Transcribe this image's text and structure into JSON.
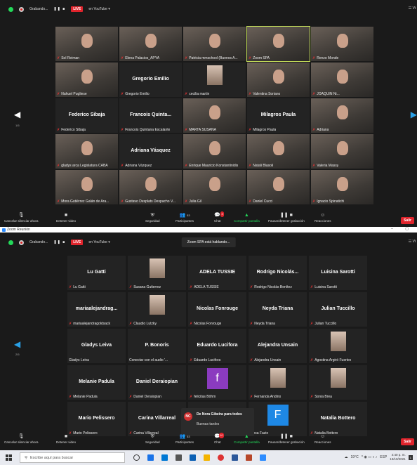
{
  "window1": {
    "recording_label": "Grabando...",
    "pause_controls": "❚❚ ■",
    "live_label": "LIVE",
    "live_target": "en YouTube ▾",
    "view_label": "☷ Vi",
    "page_indicator": "1/5",
    "tiles": [
      {
        "name": "Sol Reiman",
        "video": true
      },
      {
        "name": "Elena Palacios_APYA",
        "video": true
      },
      {
        "name": "Patricia mmschool (Buenos A...",
        "video": true
      },
      {
        "name": "Zoom SPA",
        "video": true,
        "active": true
      },
      {
        "name": "Renzo Monde",
        "video": true
      },
      {
        "name": "Nahuel Pugliese",
        "video": true
      },
      {
        "name": "Gregorio Emilio",
        "video": false,
        "center": "Gregorio Emilio"
      },
      {
        "name": "cecilia martin",
        "video": false,
        "photo": true
      },
      {
        "name": "Valentina Soriano",
        "video": true
      },
      {
        "name": "JOAQUIN Ni...",
        "video": true
      },
      {
        "name": "Federico Sibaja",
        "video": false,
        "center": "Federico Sibaja"
      },
      {
        "name": "Francois Quintana Escalante",
        "video": false,
        "center": "Francois Quinta..."
      },
      {
        "name": "MARTA SUSANA",
        "video": true
      },
      {
        "name": "Milagros Paula",
        "video": false,
        "center": "Milagros Paula"
      },
      {
        "name": "Adriana",
        "video": true
      },
      {
        "name": "gladys arca Legislatura CABA",
        "video": true
      },
      {
        "name": "Adriana Vázquez",
        "video": false,
        "center": "Adriana Vásquez"
      },
      {
        "name": "Enrique Mauricio Konstantinidis",
        "video": true
      },
      {
        "name": "Natali Blasoli",
        "video": true
      },
      {
        "name": "Valeria Massy",
        "video": true
      },
      {
        "name": "Mora Gutiérrez Galán de Ara...",
        "video": true
      },
      {
        "name": "Gustavo Desplats Despacho V...",
        "video": true
      },
      {
        "name": "Julia Gil",
        "video": true
      },
      {
        "name": "Daniel Cucci",
        "video": true
      },
      {
        "name": "Ignacio Spinatichi",
        "video": true
      }
    ],
    "toolbar": {
      "mute_label": "Cancelar silenciar ahora",
      "video_label": "Detener video",
      "security_label": "Seguridad",
      "participants_label": "Participantes",
      "participants_count": "53",
      "chat_label": "Chat",
      "chat_badge": "3",
      "share_label": "Compartir pantalla",
      "record_label": "Pausar/detener grabación",
      "reactions_label": "Reacciones",
      "end_label": "Salir"
    }
  },
  "zoom_titlebar": {
    "title": "Zoom Reunión",
    "controls": "–  ▢"
  },
  "window2": {
    "recording_label": "Grabando...",
    "pause_controls": "❚❚ ■",
    "live_label": "LIVE",
    "live_target": "en YouTube ▾",
    "view_label": "☷ Vi",
    "speaking": "Zoom SPA está hablando...",
    "page_indicator": "2/5",
    "tiles": [
      {
        "name": "Lu Gatti",
        "center": "Lu Gatti"
      },
      {
        "name": "Susana Gutierrez",
        "photo": true
      },
      {
        "name": "ADELA TUSSIE",
        "center": "ADELA TUSSIE"
      },
      {
        "name": "Rodrigo Nicolás Benítez",
        "center": "Rodrigo Nicolás..."
      },
      {
        "name": "Luisina Sarotti",
        "center": "Luisina Sarotti"
      },
      {
        "name": "mariaalejandragoldsack",
        "center": "mariaalejandrag..."
      },
      {
        "name": "Claudio Lutzky",
        "photo": true
      },
      {
        "name": "Nicolas Fonrouge",
        "center": "Nicolas Fonrouge"
      },
      {
        "name": "Neyda Triana",
        "center": "Neyda Triana"
      },
      {
        "name": "Julian Tuccillo",
        "center": "Julian Tuccillo"
      },
      {
        "name": "Gladys Leiva",
        "center": "Gladys Leiva",
        "nomute": true
      },
      {
        "name": "Conectar con el audio '...",
        "center": "P. Bonoris",
        "nomute": true
      },
      {
        "name": "Eduardo Lucifora",
        "center": "Eduardo Lucifora"
      },
      {
        "name": "Alejandra Unsain",
        "center": "Alejandra Unsain"
      },
      {
        "name": "Agostina Argiró Fuertes",
        "photo": true
      },
      {
        "name": "Melanie Padula",
        "center": "Melanie Padula"
      },
      {
        "name": "Daniel Deraiopian",
        "center": "Daniel Deraiopian"
      },
      {
        "name": "felicitas Böhm",
        "letter": "f",
        "color": "#8b3bbf"
      },
      {
        "name": "Fernanda Andino",
        "photo": true
      },
      {
        "name": "Sonia Brea",
        "photo": true
      },
      {
        "name": "Mario  Pelissero",
        "center": "Mario  Pelissero"
      },
      {
        "name": "Carina Villarreal",
        "center": "Carina Villarreal"
      },
      {
        "name": "",
        "center": ""
      },
      {
        "name": "eresa Fazio",
        "letter": "F",
        "color": "#1e88e5",
        "nomute": true
      },
      {
        "name": "Natalia Bottero",
        "center": "Natalia Bottero"
      }
    ],
    "chat_popup": {
      "avatar": "NC",
      "from": "De Nora Gibeira para todos",
      "message": "Buenas tardes"
    },
    "toolbar": {
      "mute_label": "Cancelar silenciar ahora",
      "video_label": "Detener video",
      "security_label": "Seguridad",
      "participants_label": "Participantes",
      "participants_count": "53",
      "chat_label": "Chat",
      "chat_badge": "10",
      "share_label": "Compartir pantalla",
      "record_label": "Pausar/detener grabación",
      "reactions_label": "Reacciones",
      "end_label": "Salir"
    }
  },
  "taskbar": {
    "search_placeholder": "Escribe aquí para buscar",
    "weather": "19°C",
    "language": "ESP",
    "time": "4:40 p. m.",
    "date": "13/10/2021",
    "notification_count": "1"
  },
  "colors": {
    "live_red": "#e0242c",
    "share_green": "#23d959",
    "active_speaker": "#c6e05a",
    "nav_blue": "#29a0e6"
  }
}
